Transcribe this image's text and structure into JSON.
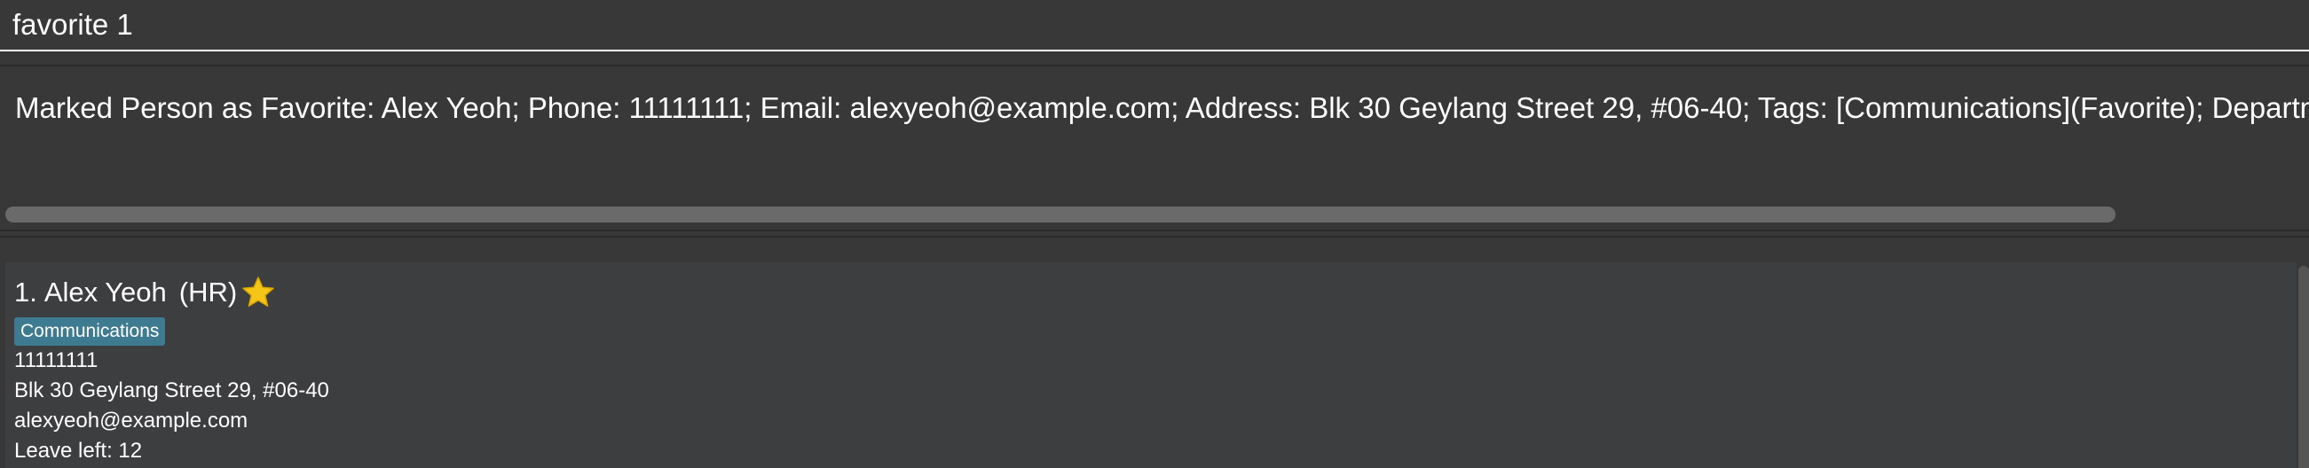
{
  "command_box": {
    "value": "favorite 1"
  },
  "result_display": {
    "text": "Marked Person as Favorite: Alex Yeoh; Phone: 11111111; Email: alexyeoh@example.com; Address: Blk 30 Geylang Street 29, #06-40; Tags: [Communications](Favorite); Department: HR"
  },
  "person_list": {
    "items": [
      {
        "index": "1.",
        "name": "Alex Yeoh",
        "department": "(HR)",
        "favorite_icon": "star-icon",
        "tags": [
          "Communications"
        ],
        "phone": "11111111",
        "address": "Blk 30 Geylang Street 29, #06-40",
        "email": "alexyeoh@example.com",
        "leave": "Leave left: 12"
      }
    ]
  },
  "colors": {
    "background": "#383838",
    "tag": "#3e7b91",
    "star": "#f5c518",
    "card": "#3c3e3f"
  }
}
